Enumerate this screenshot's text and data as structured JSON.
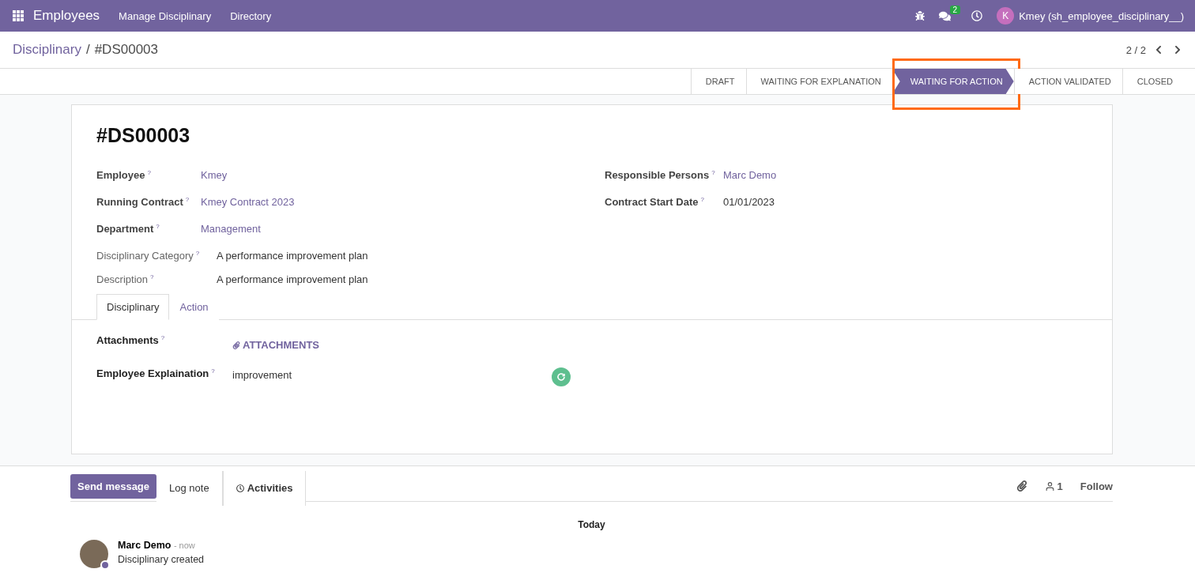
{
  "navbar": {
    "app": "Employees",
    "menus": [
      "Manage Disciplinary",
      "Directory"
    ],
    "message_count": "2",
    "user_initial": "K",
    "user": "Kmey (sh_employee_disciplinary__)"
  },
  "breadcrumb": {
    "parent": "Disciplinary",
    "separator": "/",
    "current": "#DS00003"
  },
  "pager": "2 / 2",
  "stages": [
    {
      "label": "DRAFT",
      "selected": false
    },
    {
      "label": "WAITING FOR EXPLANATION",
      "selected": false
    },
    {
      "label": "WAITING FOR ACTION",
      "selected": true,
      "highlighted": true
    },
    {
      "label": "ACTION VALIDATED",
      "selected": false
    },
    {
      "label": "CLOSED",
      "selected": false
    }
  ],
  "record": {
    "title": "#DS00003",
    "left_fields": [
      {
        "label": "Employee",
        "value": "Kmey",
        "kind": "link"
      },
      {
        "label": "Running Contract",
        "value": "Kmey Contract 2023",
        "kind": "link"
      },
      {
        "label": "Department",
        "value": "Management",
        "kind": "link"
      }
    ],
    "right_fields": [
      {
        "label": "Responsible Persons",
        "value": "Marc Demo",
        "kind": "link"
      },
      {
        "label": "Contract Start Date",
        "value": "01/01/2023",
        "kind": "text"
      }
    ],
    "plain_fields": [
      {
        "label": "Disciplinary Category",
        "value": "A performance improvement plan"
      },
      {
        "label": "Description",
        "value": "A performance improvement plan"
      }
    ],
    "help_mark": "?",
    "tabs": [
      {
        "label": "Disciplinary",
        "selected": true
      },
      {
        "label": "Action",
        "selected": false
      }
    ],
    "attachments": {
      "label": "Attachments",
      "button": "ATTACHMENTS"
    },
    "explanation": {
      "label": "Employee Explaination",
      "value": "improvement"
    }
  },
  "chatter": {
    "send": "Send message",
    "log": "Log note",
    "activities": "Activities",
    "followers": "1",
    "follow": "Follow",
    "day": "Today",
    "messages": [
      {
        "author": "Marc Demo",
        "time": "- now",
        "body": "Disciplinary created"
      }
    ]
  }
}
